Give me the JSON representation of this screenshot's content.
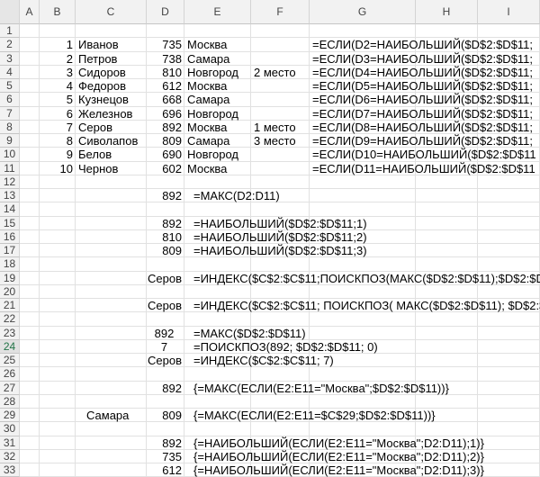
{
  "columns": [
    "A",
    "B",
    "C",
    "D",
    "E",
    "F",
    "G",
    "H",
    "I"
  ],
  "rows": [
    "1",
    "2",
    "3",
    "4",
    "5",
    "6",
    "7",
    "8",
    "9",
    "10",
    "11",
    "12",
    "13",
    "14",
    "15",
    "16",
    "17",
    "18",
    "19",
    "20",
    "21",
    "22",
    "23",
    "24",
    "25",
    "26",
    "27",
    "28",
    "29",
    "30",
    "31",
    "32",
    "33"
  ],
  "selected_row": "24",
  "cells": [
    {
      "ref": "B2",
      "value": "1",
      "align": "r"
    },
    {
      "ref": "C2",
      "value": "Иванов"
    },
    {
      "ref": "D2",
      "value": "735",
      "align": "r"
    },
    {
      "ref": "E2",
      "value": "Москва"
    },
    {
      "ref": "G2",
      "value": "=ЕСЛИ(D2=НАИБОЛЬШИЙ($D$2:$D$11;"
    },
    {
      "ref": "B3",
      "value": "2",
      "align": "r"
    },
    {
      "ref": "C3",
      "value": "Петров"
    },
    {
      "ref": "D3",
      "value": "738",
      "align": "r"
    },
    {
      "ref": "E3",
      "value": "Самара"
    },
    {
      "ref": "G3",
      "value": "=ЕСЛИ(D3=НАИБОЛЬШИЙ($D$2:$D$11;"
    },
    {
      "ref": "B4",
      "value": "3",
      "align": "r"
    },
    {
      "ref": "C4",
      "value": "Сидоров"
    },
    {
      "ref": "D4",
      "value": "810",
      "align": "r"
    },
    {
      "ref": "E4",
      "value": "Новгород"
    },
    {
      "ref": "F4",
      "value": "2 место"
    },
    {
      "ref": "G4",
      "value": "=ЕСЛИ(D4=НАИБОЛЬШИЙ($D$2:$D$11;"
    },
    {
      "ref": "B5",
      "value": "4",
      "align": "r"
    },
    {
      "ref": "C5",
      "value": "Федоров"
    },
    {
      "ref": "D5",
      "value": "612",
      "align": "r"
    },
    {
      "ref": "E5",
      "value": "Москва"
    },
    {
      "ref": "G5",
      "value": "=ЕСЛИ(D5=НАИБОЛЬШИЙ($D$2:$D$11;"
    },
    {
      "ref": "B6",
      "value": "5",
      "align": "r"
    },
    {
      "ref": "C6",
      "value": "Кузнецов"
    },
    {
      "ref": "D6",
      "value": "668",
      "align": "r"
    },
    {
      "ref": "E6",
      "value": "Самара"
    },
    {
      "ref": "G6",
      "value": "=ЕСЛИ(D6=НАИБОЛЬШИЙ($D$2:$D$11;"
    },
    {
      "ref": "B7",
      "value": "6",
      "align": "r"
    },
    {
      "ref": "C7",
      "value": "Железнов"
    },
    {
      "ref": "D7",
      "value": "696",
      "align": "r"
    },
    {
      "ref": "E7",
      "value": "Новгород"
    },
    {
      "ref": "G7",
      "value": "=ЕСЛИ(D7=НАИБОЛЬШИЙ($D$2:$D$11;"
    },
    {
      "ref": "B8",
      "value": "7",
      "align": "r"
    },
    {
      "ref": "C8",
      "value": "Серов"
    },
    {
      "ref": "D8",
      "value": "892",
      "align": "r"
    },
    {
      "ref": "E8",
      "value": "Москва"
    },
    {
      "ref": "F8",
      "value": "1 место"
    },
    {
      "ref": "G8",
      "value": "=ЕСЛИ(D8=НАИБОЛЬШИЙ($D$2:$D$11;"
    },
    {
      "ref": "B9",
      "value": "8",
      "align": "r"
    },
    {
      "ref": "C9",
      "value": "Сиволапов"
    },
    {
      "ref": "D9",
      "value": "809",
      "align": "r"
    },
    {
      "ref": "E9",
      "value": "Самара"
    },
    {
      "ref": "F9",
      "value": "3 место"
    },
    {
      "ref": "G9",
      "value": "=ЕСЛИ(D9=НАИБОЛЬШИЙ($D$2:$D$11;"
    },
    {
      "ref": "B10",
      "value": "9",
      "align": "r"
    },
    {
      "ref": "C10",
      "value": "Белов"
    },
    {
      "ref": "D10",
      "value": "690",
      "align": "r"
    },
    {
      "ref": "E10",
      "value": "Новгород"
    },
    {
      "ref": "G10",
      "value": "=ЕСЛИ(D10=НАИБОЛЬШИЙ($D$2:$D$11"
    },
    {
      "ref": "B11",
      "value": "10",
      "align": "r"
    },
    {
      "ref": "C11",
      "value": "Чернов"
    },
    {
      "ref": "D11",
      "value": "602",
      "align": "r"
    },
    {
      "ref": "E11",
      "value": "Москва"
    },
    {
      "ref": "G11",
      "value": "=ЕСЛИ(D11=НАИБОЛЬШИЙ($D$2:$D$11"
    },
    {
      "ref": "D13",
      "value": "892",
      "align": "r"
    },
    {
      "ref": "E13",
      "value": "=МАКС(D2:D11)",
      "pad": 10
    },
    {
      "ref": "D15",
      "value": "892",
      "align": "r"
    },
    {
      "ref": "E15",
      "value": "=НАИБОЛЬШИЙ($D$2:$D$11;1)",
      "pad": 10
    },
    {
      "ref": "D16",
      "value": "810",
      "align": "r"
    },
    {
      "ref": "E16",
      "value": "=НАИБОЛЬШИЙ($D$2:$D$11;2)",
      "pad": 10
    },
    {
      "ref": "D17",
      "value": "809",
      "align": "r"
    },
    {
      "ref": "E17",
      "value": "=НАИБОЛЬШИЙ($D$2:$D$11;3)",
      "pad": 10
    },
    {
      "ref": "D19",
      "value": "Серов",
      "align": "r"
    },
    {
      "ref": "E19",
      "value": "=ИНДЕКС($C$2:$C$11;ПОИСКПОЗ(МАКС($D$2:$D$11);$D$2:$D$1",
      "pad": 10
    },
    {
      "ref": "D21",
      "value": "Серов",
      "align": "r"
    },
    {
      "ref": "E21",
      "value": "=ИНДЕКС($C$2:$C$11;  ПОИСКПОЗ( МАКС($D$2:$D$11);  $D$2:$",
      "pad": 10
    },
    {
      "ref": "D23",
      "value": "892",
      "align": "c"
    },
    {
      "ref": "E23",
      "value": "=МАКС($D$2:$D$11)",
      "pad": 10
    },
    {
      "ref": "D24",
      "value": "7",
      "align": "c"
    },
    {
      "ref": "E24",
      "value": "=ПОИСКПОЗ(892;  $D$2:$D$11;  0)",
      "pad": 10
    },
    {
      "ref": "D25",
      "value": "Серов",
      "align": "r"
    },
    {
      "ref": "E25",
      "value": "=ИНДЕКС($C$2:$C$11;  7)",
      "pad": 10
    },
    {
      "ref": "D27",
      "value": "892",
      "align": "r"
    },
    {
      "ref": "E27",
      "value": "{=МАКС(ЕСЛИ(E2:E11=\"Москва\";$D$2:$D$11))}",
      "pad": 10
    },
    {
      "ref": "C29",
      "value": "Самара",
      "pad": 12
    },
    {
      "ref": "D29",
      "value": "809",
      "align": "r"
    },
    {
      "ref": "E29",
      "value": "{=МАКС(ЕСЛИ(E2:E11=$C$29;$D$2:$D$11))}",
      "pad": 10
    },
    {
      "ref": "D31",
      "value": "892",
      "align": "r"
    },
    {
      "ref": "E31",
      "value": "{=НАИБОЛЬШИЙ(ЕСЛИ(E2:E11=\"Москва\";D2:D11);1)}",
      "pad": 10
    },
    {
      "ref": "D32",
      "value": "735",
      "align": "r"
    },
    {
      "ref": "E32",
      "value": "{=НАИБОЛЬШИЙ(ЕСЛИ(E2:E11=\"Москва\";D2:D11);2)}",
      "pad": 10
    },
    {
      "ref": "D33",
      "value": "612",
      "align": "r"
    },
    {
      "ref": "E33",
      "value": "{=НАИБОЛЬШИЙ(ЕСЛИ(E2:E11=\"Москва\";D2:D11);3)}",
      "pad": 10
    }
  ]
}
